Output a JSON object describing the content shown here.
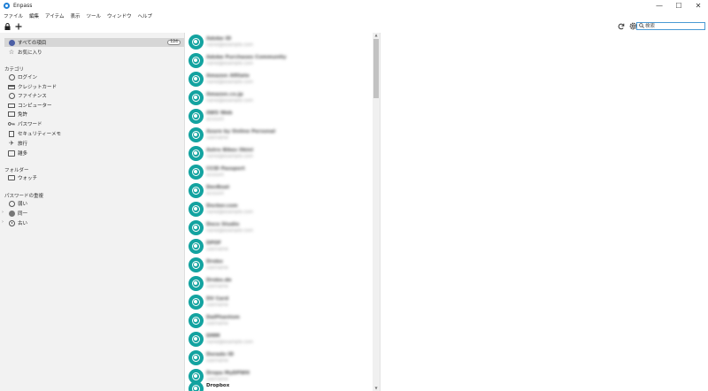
{
  "app": {
    "title": "Enpass"
  },
  "window_controls": {
    "minimize": "—",
    "maximize": "☐",
    "close": "✕"
  },
  "menu": [
    "ファイル",
    "編集",
    "アイテム",
    "表示",
    "ツール",
    "ウィンドウ",
    "ヘルプ"
  ],
  "toolbar": {
    "search_placeholder": "検索"
  },
  "sidebar": {
    "all_items": {
      "label": "すべての項目",
      "count": "124"
    },
    "favorites": {
      "label": "お気に入り"
    },
    "categories_header": "カテゴリ",
    "categories": [
      {
        "label": "ログイン",
        "icon": "login-icon"
      },
      {
        "label": "クレジットカード",
        "icon": "credit-card-icon"
      },
      {
        "label": "ファイナンス",
        "icon": "finance-icon"
      },
      {
        "label": "コンピューター",
        "icon": "computer-icon"
      },
      {
        "label": "免許",
        "icon": "license-icon"
      },
      {
        "label": "パスワード",
        "icon": "key-icon"
      },
      {
        "label": "セキュリティーメモ",
        "icon": "note-icon"
      },
      {
        "label": "旅行",
        "icon": "plane-icon"
      },
      {
        "label": "雑多",
        "icon": "misc-icon"
      }
    ],
    "folders_header": "フォルダー",
    "folders": [
      {
        "label": "ウォッチ"
      }
    ],
    "password_strength_header": "パスワードの重複",
    "strength": [
      {
        "label": "弱い"
      },
      {
        "label": "同一"
      },
      {
        "label": "古い"
      }
    ]
  },
  "list_items": [
    {
      "title": "Adobe ID",
      "subtitle": "name@example.com"
    },
    {
      "title": "Adobe Purchases Community",
      "subtitle": "name@example.com"
    },
    {
      "title": "Amazon Afiliate",
      "subtitle": "name@example.com"
    },
    {
      "title": "Amazon.co.jp",
      "subtitle": "name@example.com"
    },
    {
      "title": "AWS Web",
      "subtitle": "account"
    },
    {
      "title": "Azure by Online Personal",
      "subtitle": "username"
    },
    {
      "title": "Astro Bikes Okinl",
      "subtitle": "name@example.com"
    },
    {
      "title": "CCID Passport",
      "subtitle": "account"
    },
    {
      "title": "DevBoat",
      "subtitle": "account"
    },
    {
      "title": "Docker.com",
      "subtitle": "name@example.com"
    },
    {
      "title": "Doco Studio",
      "subtitle": "name@example.com"
    },
    {
      "title": "DPOF",
      "subtitle": "username"
    },
    {
      "title": "Drobo",
      "subtitle": "username"
    },
    {
      "title": "Drobo.de",
      "subtitle": "username"
    },
    {
      "title": "DV Card",
      "subtitle": "username"
    },
    {
      "title": "DaiPhantom",
      "subtitle": "username"
    },
    {
      "title": "DMM",
      "subtitle": "name@example.com"
    },
    {
      "title": "Dorado ID",
      "subtitle": "username"
    },
    {
      "title": "Dropa MyDPWH",
      "subtitle": "username"
    },
    {
      "title": "Dropbox",
      "subtitle": ""
    }
  ],
  "scrollbar": {
    "up": "▲",
    "down": "▼"
  }
}
